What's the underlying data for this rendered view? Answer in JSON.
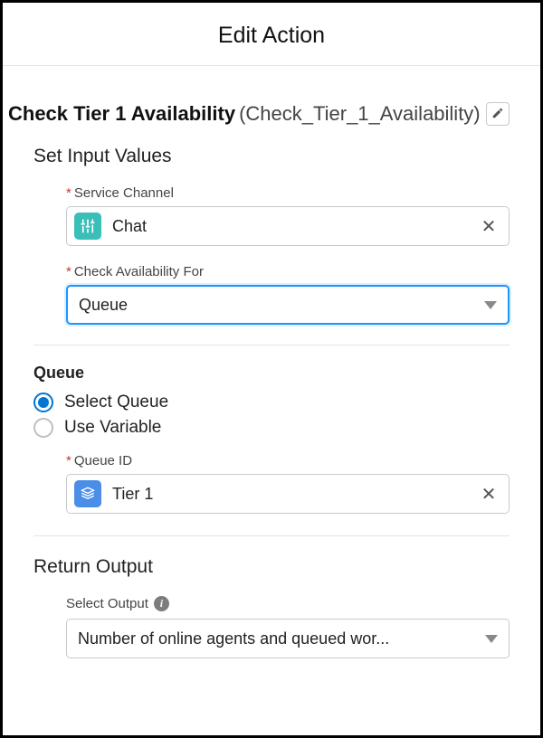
{
  "dialog": {
    "title": "Edit Action"
  },
  "action": {
    "name": "Check Tier 1 Availability",
    "api_name": "(Check_Tier_1_Availability)"
  },
  "sections": {
    "input_title": "Set Input Values",
    "output_title": "Return Output"
  },
  "fields": {
    "service_channel": {
      "label": "Service Channel",
      "value": "Chat"
    },
    "check_availability_for": {
      "label": "Check Availability For",
      "value": "Queue"
    },
    "queue_id": {
      "label": "Queue ID",
      "value": "Tier 1"
    },
    "select_output": {
      "label": "Select Output",
      "value": "Number of online agents and queued wor..."
    }
  },
  "queue_group": {
    "title": "Queue",
    "options": {
      "select_queue": "Select Queue",
      "use_variable": "Use Variable"
    },
    "selected": "select_queue"
  }
}
